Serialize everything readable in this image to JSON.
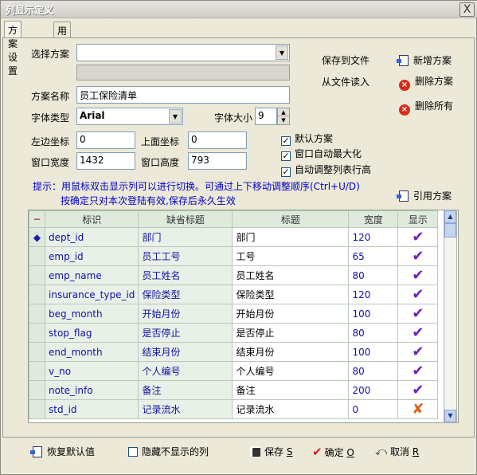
{
  "window": {
    "title": "列显示定义",
    "close_label": "X"
  },
  "tabs": [
    {
      "label": "方案设置"
    },
    {
      "label": "用户绑定"
    }
  ],
  "form": {
    "select_scheme_label": "选择方案",
    "select_scheme_value": "",
    "scheme_name_label": "方案名称",
    "scheme_name_value": "员工保险清单",
    "font_type_label": "字体类型",
    "font_type_value": "Arial",
    "font_size_label": "字体大小",
    "font_size_value": "9",
    "left_label": "左边坐标",
    "left_value": "0",
    "top_label": "上面坐标",
    "top_value": "0",
    "width_label": "窗口宽度",
    "width_value": "1432",
    "height_label": "窗口高度",
    "height_value": "793"
  },
  "actions": {
    "save_to_file": "保存到文件",
    "load_from_file": "从文件读入",
    "new_scheme": "新增方案",
    "delete_scheme": "删除方案",
    "delete_all": "删除所有",
    "cite_scheme": "引用方案"
  },
  "checkboxes": [
    {
      "label": "默认方案",
      "checked": true
    },
    {
      "label": "窗口自动最大化",
      "checked": true
    },
    {
      "label": "自动调整列表行高",
      "checked": true
    }
  ],
  "hint": {
    "line1": "提示：用鼠标双击显示列可以进行切换。可通过上下移动调整顺序(Ctrl+U/D)",
    "line2": "按确定只对本次登陆有效,保存后永久生效"
  },
  "grid": {
    "indicator_header": "−",
    "columns": [
      "标识",
      "缺省标题",
      "标题",
      "宽度",
      "显示"
    ],
    "current_marker": "◆",
    "rows": [
      {
        "id": "dept_id",
        "default_title": "部门",
        "title": "部门",
        "width": "120",
        "show": "✔"
      },
      {
        "id": "emp_id",
        "default_title": "员工工号",
        "title": "工号",
        "width": "65",
        "show": "✔"
      },
      {
        "id": "emp_name",
        "default_title": "员工姓名",
        "title": "员工姓名",
        "width": "80",
        "show": "✔"
      },
      {
        "id": "insurance_type_id",
        "default_title": "保险类型",
        "title": "保险类型",
        "width": "120",
        "show": "✔"
      },
      {
        "id": "beg_month",
        "default_title": "开始月份",
        "title": "开始月份",
        "width": "100",
        "show": "✔"
      },
      {
        "id": "stop_flag",
        "default_title": "是否停止",
        "title": "是否停止",
        "width": "80",
        "show": "✔"
      },
      {
        "id": "end_month",
        "default_title": "结束月份",
        "title": "结束月份",
        "width": "100",
        "show": "✔"
      },
      {
        "id": "v_no",
        "default_title": "个人编号",
        "title": "个人编号",
        "width": "80",
        "show": "✔"
      },
      {
        "id": "note_info",
        "default_title": "备注",
        "title": "备注",
        "width": "200",
        "show": "✔"
      },
      {
        "id": "std_id",
        "default_title": "记录流水",
        "title": "记录流水",
        "width": "0",
        "show": "✘"
      }
    ]
  },
  "bottom": {
    "restore_default": "恢复默认值",
    "hide_unshown": "隐藏不显示的列",
    "save": "保存",
    "save_key": "S",
    "ok": "确定",
    "ok_key": "O",
    "cancel": "取消",
    "cancel_key": "R"
  }
}
